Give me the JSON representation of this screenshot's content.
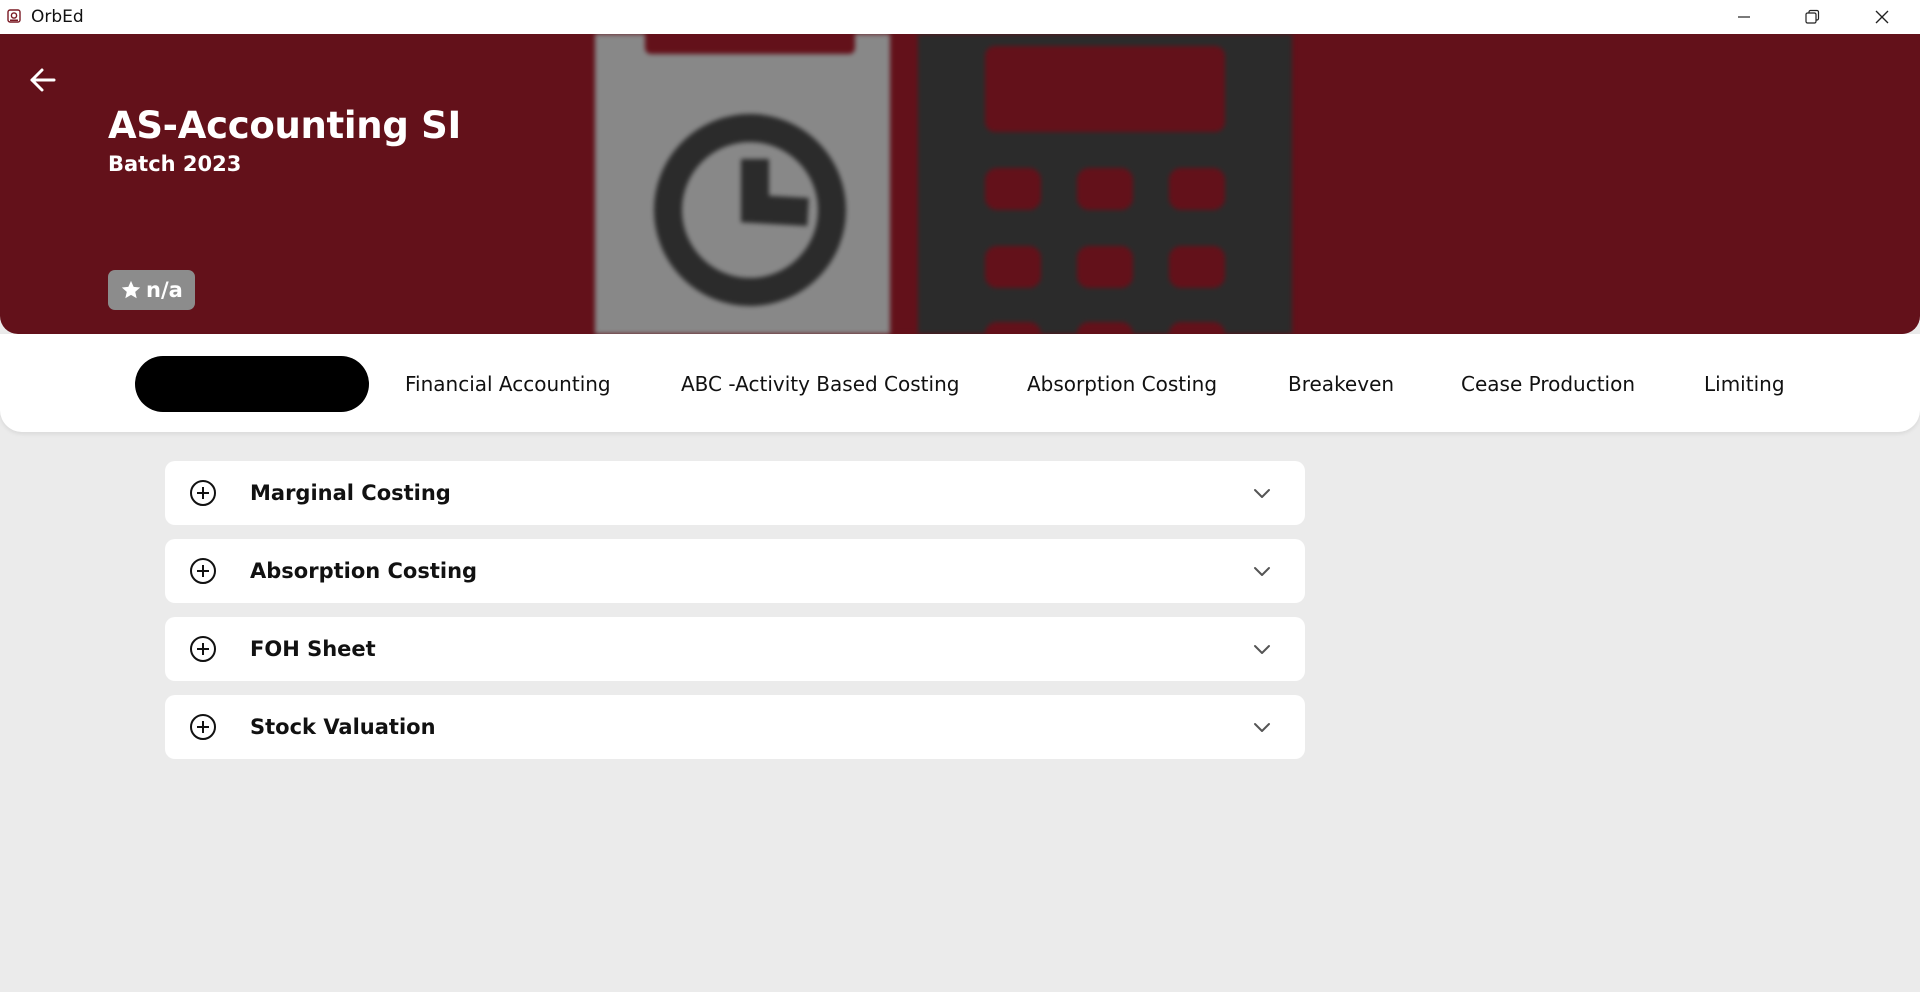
{
  "window": {
    "title": "OrbEd",
    "icons": {
      "app": "app-logo-icon",
      "minimize": "minimize-icon",
      "maximize": "restore-icon",
      "close": "close-icon"
    }
  },
  "hero": {
    "title": "AS-Accounting SI",
    "subtitle": "Batch 2023",
    "rating": "n/a",
    "back_icon": "arrow-left-icon",
    "background_color": "#63111a"
  },
  "tabs": [
    {
      "label": "",
      "active": true
    },
    {
      "label": "Financial Accounting"
    },
    {
      "label": "ABC -Activity Based Costing"
    },
    {
      "label": "Absorption Costing"
    },
    {
      "label": "Breakeven"
    },
    {
      "label": "Cease Production"
    },
    {
      "label": "Limiting"
    }
  ],
  "sections": [
    {
      "label": "Marginal Costing"
    },
    {
      "label": "Absorption Costing"
    },
    {
      "label": "FOH Sheet"
    },
    {
      "label": "Stock Valuation"
    }
  ],
  "colors": {
    "accent": "#63111a",
    "page_bg": "#ebebeb",
    "active_tab": "#000000",
    "rating_bg": "#8c8c8c"
  }
}
